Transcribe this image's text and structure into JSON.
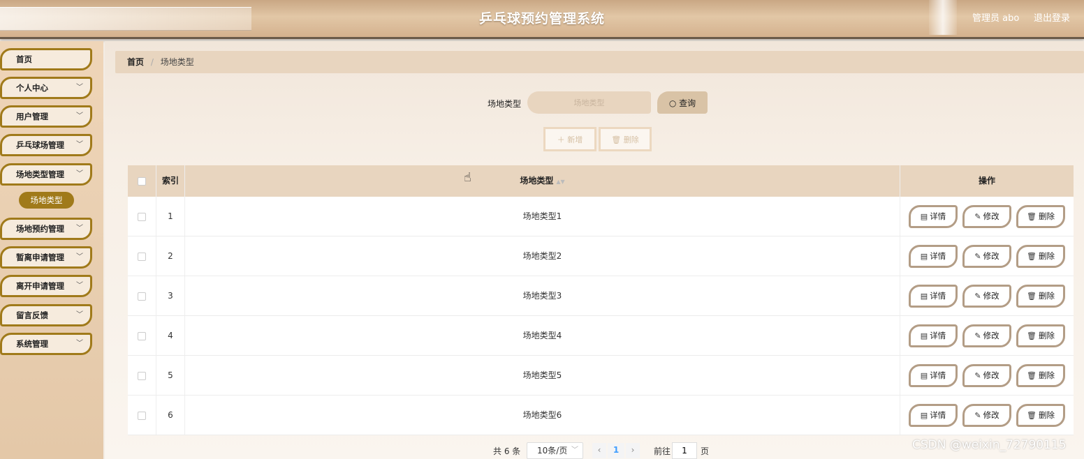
{
  "header": {
    "title": "乒乓球预约管理系统",
    "user": "管理员 abo",
    "logout": "退出登录"
  },
  "sidebar": {
    "items": [
      {
        "label": "首页",
        "has_chevron": false
      },
      {
        "label": "个人中心",
        "has_chevron": true
      },
      {
        "label": "用户管理",
        "has_chevron": true
      },
      {
        "label": "乒乓球场管理",
        "has_chevron": true
      },
      {
        "label": "场地类型管理",
        "has_chevron": true
      },
      {
        "label": "场地预约管理",
        "has_chevron": true
      },
      {
        "label": "暂离申请管理",
        "has_chevron": true
      },
      {
        "label": "离开申请管理",
        "has_chevron": true
      },
      {
        "label": "留言反馈",
        "has_chevron": true
      },
      {
        "label": "系统管理",
        "has_chevron": true
      }
    ],
    "active_sub": "场地类型"
  },
  "breadcrumb": {
    "home": "首页",
    "separator": "/",
    "current": "场地类型"
  },
  "search": {
    "label": "场地类型",
    "placeholder": "场地类型",
    "button": "查询"
  },
  "actions": {
    "add": "新增",
    "delete": "删除"
  },
  "table": {
    "headers": {
      "index": "索引",
      "type": "场地类型",
      "ops": "操作"
    },
    "rows": [
      {
        "index": "1",
        "type": "场地类型1"
      },
      {
        "index": "2",
        "type": "场地类型2"
      },
      {
        "index": "3",
        "type": "场地类型3"
      },
      {
        "index": "4",
        "type": "场地类型4"
      },
      {
        "index": "5",
        "type": "场地类型5"
      },
      {
        "index": "6",
        "type": "场地类型6"
      }
    ],
    "ops": {
      "detail": "详情",
      "edit": "修改",
      "delete": "删除"
    }
  },
  "pagination": {
    "total": "共 6 条",
    "page_size": "10条/页",
    "current_page": "1",
    "goto_label": "前往",
    "goto_value": "1",
    "page_suffix": "页"
  },
  "watermark": "CSDN @weixin_72790115",
  "colors": {
    "accent": "#a07a1a",
    "header_bg": "#d4b18e",
    "table_head": "#e8d5bf",
    "page_active": "#409eff"
  },
  "icons": {
    "search": "search-icon",
    "add": "plus-icon",
    "delete": "trash-icon",
    "detail": "document-icon",
    "edit": "pencil-icon",
    "chevron": "chevron-down-icon"
  }
}
